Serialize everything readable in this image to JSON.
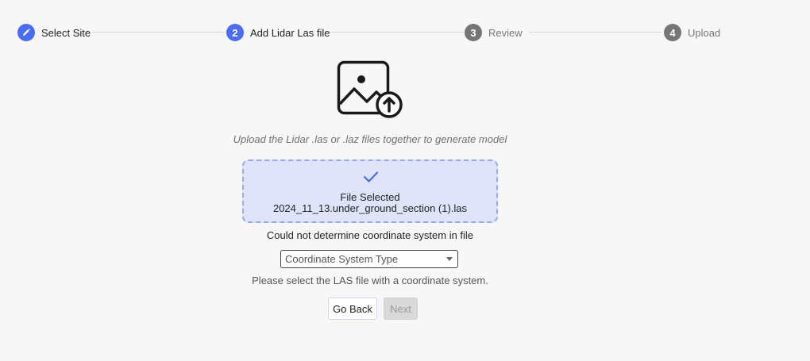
{
  "stepper": {
    "steps": [
      {
        "number": "",
        "label": "Select Site",
        "state": "completed",
        "icon": "pencil-icon"
      },
      {
        "number": "2",
        "label": "Add Lidar Las file",
        "state": "active"
      },
      {
        "number": "3",
        "label": "Review",
        "state": "inactive"
      },
      {
        "number": "4",
        "label": "Upload",
        "state": "inactive"
      }
    ]
  },
  "upload": {
    "icon": "image-upload-icon",
    "instruction": "Upload the Lidar .las or .laz files together to generate model",
    "dropzone": {
      "icon": "check-icon",
      "status": "File Selected",
      "file_name": "2024_11_13.under_ground_section (1).las"
    }
  },
  "coordinate": {
    "error": "Could not determine coordinate system in file",
    "select_value": "Coordinate System Type",
    "helper": "Please select the LAS file with a coordinate system."
  },
  "actions": {
    "back_label": "Go Back",
    "next_label": "Next"
  },
  "colors": {
    "accent": "#4a6cf0",
    "inactive_step": "#757575",
    "dropzone_bg": "#dfe4fb",
    "dropzone_border": "#96a8ee",
    "page_bg": "#f7f7f7"
  }
}
